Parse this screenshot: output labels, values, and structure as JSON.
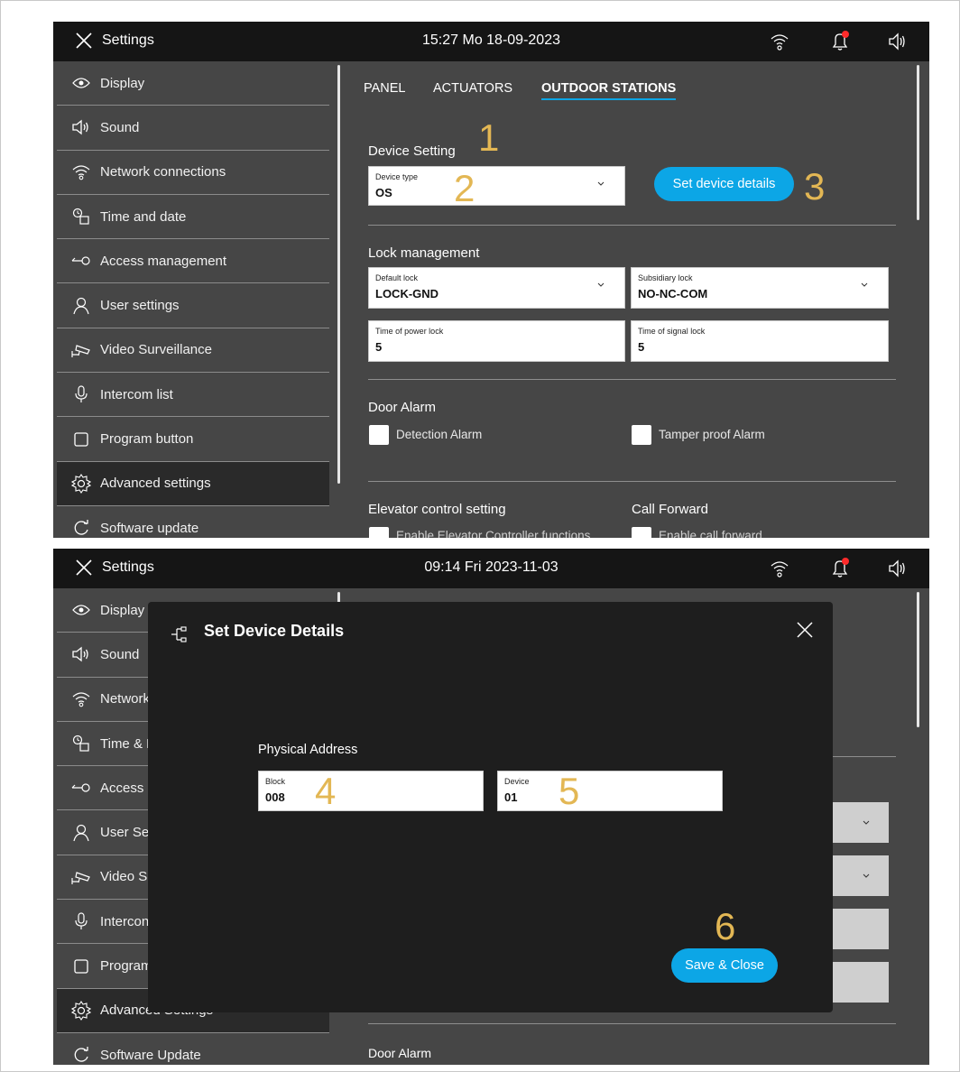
{
  "screen1": {
    "topbar": {
      "title": "Settings",
      "clock": "15:27  Mo 18-09-2023"
    },
    "sidebar": [
      {
        "label": "Display",
        "icon": "eye-icon"
      },
      {
        "label": "Sound",
        "icon": "speaker-icon"
      },
      {
        "label": "Network connections",
        "icon": "wifi-icon"
      },
      {
        "label": "Time and date",
        "icon": "clock-calendar-icon"
      },
      {
        "label": "Access  management",
        "icon": "key-icon"
      },
      {
        "label": "User settings",
        "icon": "user-icon"
      },
      {
        "label": "Video Surveillance",
        "icon": "camera-icon"
      },
      {
        "label": "Intercom list",
        "icon": "microphone-icon"
      },
      {
        "label": "Program button",
        "icon": "square-icon"
      },
      {
        "label": "Advanced settings",
        "icon": "gear-icon",
        "active": true
      },
      {
        "label": "Software update",
        "icon": "refresh-icon"
      }
    ],
    "tabs": [
      "PANEL",
      "ACTUATORS",
      "OUTDOOR STATIONS"
    ],
    "device_setting": {
      "title": "Device Setting",
      "device_type_label": "Device type",
      "device_type_value": "OS",
      "set_details_button": "Set device details"
    },
    "lock": {
      "title": "Lock management",
      "default_lock_label": "Default lock",
      "default_lock_value": "LOCK-GND",
      "subsidiary_lock_label": "Subsidiary lock",
      "subsidiary_lock_value": "NO-NC-COM",
      "power_lock_label": "Time of power lock",
      "power_lock_value": "5",
      "signal_lock_label": "Time of signal lock",
      "signal_lock_value": "5"
    },
    "door_alarm": {
      "title": "Door Alarm",
      "detection": "Detection Alarm",
      "tamper": "Tamper proof Alarm"
    },
    "elevator": {
      "title": "Elevator control setting",
      "enable": "Enable Elevator Controller functions"
    },
    "forward": {
      "title": "Call Forward",
      "enable": "Enable call forward"
    }
  },
  "screen2": {
    "topbar": {
      "title": "Settings",
      "clock": "09:14  Fri 2023-11-03"
    },
    "sidebar": [
      {
        "label": "Display",
        "icon": "eye-icon"
      },
      {
        "label": "Sound",
        "icon": "speaker-icon"
      },
      {
        "label": "Network",
        "icon": "wifi-icon"
      },
      {
        "label": "Time & D",
        "icon": "clock-calendar-icon"
      },
      {
        "label": "Access N",
        "icon": "key-icon"
      },
      {
        "label": "User Set",
        "icon": "user-icon"
      },
      {
        "label": "Video Su",
        "icon": "camera-icon"
      },
      {
        "label": "Intercon",
        "icon": "microphone-icon"
      },
      {
        "label": "Program",
        "icon": "square-icon"
      },
      {
        "label": "Advanced Settings",
        "icon": "gear-icon",
        "active": true
      },
      {
        "label": "Software Update",
        "icon": "refresh-icon"
      }
    ],
    "modal": {
      "title": "Set Device Details",
      "physical_address": "Physical Address",
      "block_label": "Block",
      "block_value": "008",
      "device_label": "Device",
      "device_value": "01",
      "save_button": "Save & Close"
    },
    "door_alarm_title": "Door Alarm"
  },
  "callouts": [
    "1",
    "2",
    "3",
    "4",
    "5",
    "6"
  ],
  "colors": {
    "accent": "#0ca6e6",
    "callout": "#e3b754",
    "panel": "#464646",
    "topbar": "#151515"
  }
}
